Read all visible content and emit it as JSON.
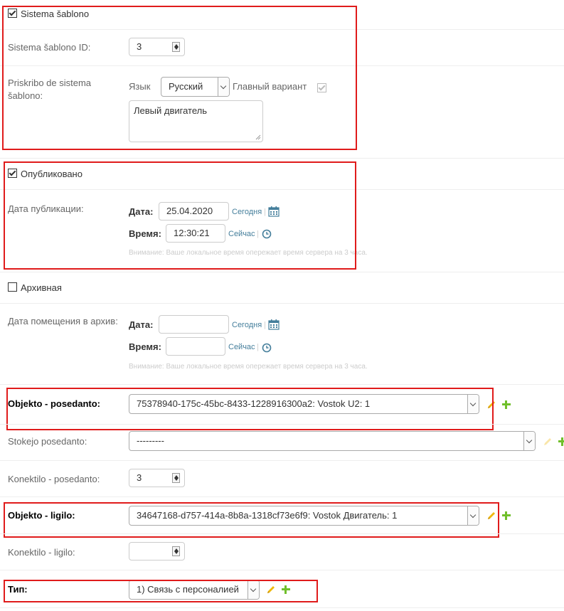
{
  "system_template": {
    "checkbox_label": "Sistema šablono",
    "checked": true,
    "id_label": "Sistema šablono ID:",
    "id_value": "3",
    "desc_label_line1": "Priskribo de sistema",
    "desc_label_line2": "šablono:",
    "lang_label": "Язык",
    "lang_value": "Русский",
    "main_variant_label": "Главный вариант",
    "main_variant_checked": true,
    "desc_value": "Левый двигатель"
  },
  "published": {
    "checkbox_label": "Опубликовано",
    "checked": true,
    "date_label": "Дата публикации:",
    "date_sub_label": "Дата:",
    "date_value": "25.04.2020",
    "today_link": "Сегодня",
    "time_sub_label": "Время:",
    "time_value": "12:30:21",
    "now_link": "Сейчас",
    "note": "Внимание: Ваше локальное время опережает время сервера на 3 часа."
  },
  "archived": {
    "checkbox_label": "Архивная",
    "checked": false,
    "date_label": "Дата помещения в архив:",
    "date_sub_label": "Дата:",
    "date_value": "",
    "today_link": "Сегодня",
    "time_sub_label": "Время:",
    "time_value": "",
    "now_link": "Сейчас",
    "note": "Внимание: Ваше локальное время опережает время сервера на 3 часа."
  },
  "owner_object": {
    "label": "Objekto - posedanto:",
    "value": "75378940-175c-45bc-8433-1228916300a2: Vostok U2: 1"
  },
  "owner_warehouse": {
    "label": "Stokejo posedanto:",
    "value": "---------"
  },
  "owner_connector": {
    "label": "Konektilo - posedanto:",
    "value": "3"
  },
  "linked_object": {
    "label": "Objekto - ligilo:",
    "value": "34647168-d757-414a-8b8a-1318cf73e6f9: Vostok Двигатель: 1"
  },
  "linked_connector": {
    "label": "Konektilo - ligilo:",
    "value": ""
  },
  "type": {
    "label": "Тип:",
    "value": "1) Связь с персоналией"
  },
  "colors": {
    "highlight_border": "#e01b1b",
    "link": "#447e9b",
    "add_icon": "#70bf2b",
    "edit_icon": "#efb80b"
  }
}
